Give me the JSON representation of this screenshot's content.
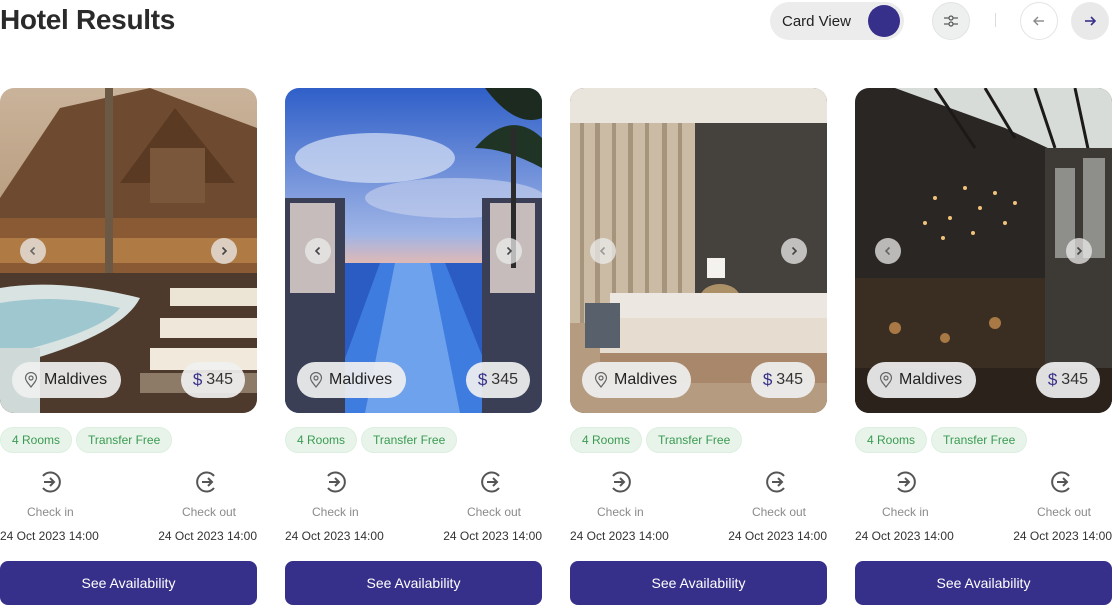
{
  "header": {
    "title": "Hotel Results",
    "view_toggle_label": "Card View",
    "accent_color": "#37308a"
  },
  "cards": [
    {
      "location": "Maldives",
      "currency": "$",
      "price": "345",
      "tags": [
        "4 Rooms",
        "Transfer Free"
      ],
      "check_in_label": "Check in",
      "check_in_date": "24 Oct 2023 14:00",
      "check_out_label": "Check out",
      "check_out_date": "24 Oct 2023 14:00",
      "button_label": "See Availability",
      "image": "wooden resort with pool"
    },
    {
      "location": "Maldives",
      "currency": "$",
      "price": "345",
      "tags": [
        "4 Rooms",
        "Transfer Free"
      ],
      "check_in_label": "Check in",
      "check_in_date": "24 Oct 2023 14:00",
      "check_out_label": "Check out",
      "check_out_date": "24 Oct 2023 14:00",
      "button_label": "See Availability",
      "image": "infinity pool at sunset with palm trees"
    },
    {
      "location": "Maldives",
      "currency": "$",
      "price": "345",
      "tags": [
        "4 Rooms",
        "Transfer Free"
      ],
      "check_in_label": "Check in",
      "check_in_date": "24 Oct 2023 14:00",
      "check_out_label": "Check out",
      "check_out_date": "24 Oct 2023 14:00",
      "button_label": "See Availability",
      "image": "modern hotel bedroom"
    },
    {
      "location": "Maldives",
      "currency": "$",
      "price": "345",
      "tags": [
        "4 Rooms",
        "Transfer Free"
      ],
      "check_in_label": "Check in",
      "check_in_date": "24 Oct 2023 14:00",
      "check_out_label": "Check out",
      "check_out_date": "24 Oct 2023 14:00",
      "button_label": "See Availability",
      "image": "industrial lobby with chandeliers"
    }
  ]
}
